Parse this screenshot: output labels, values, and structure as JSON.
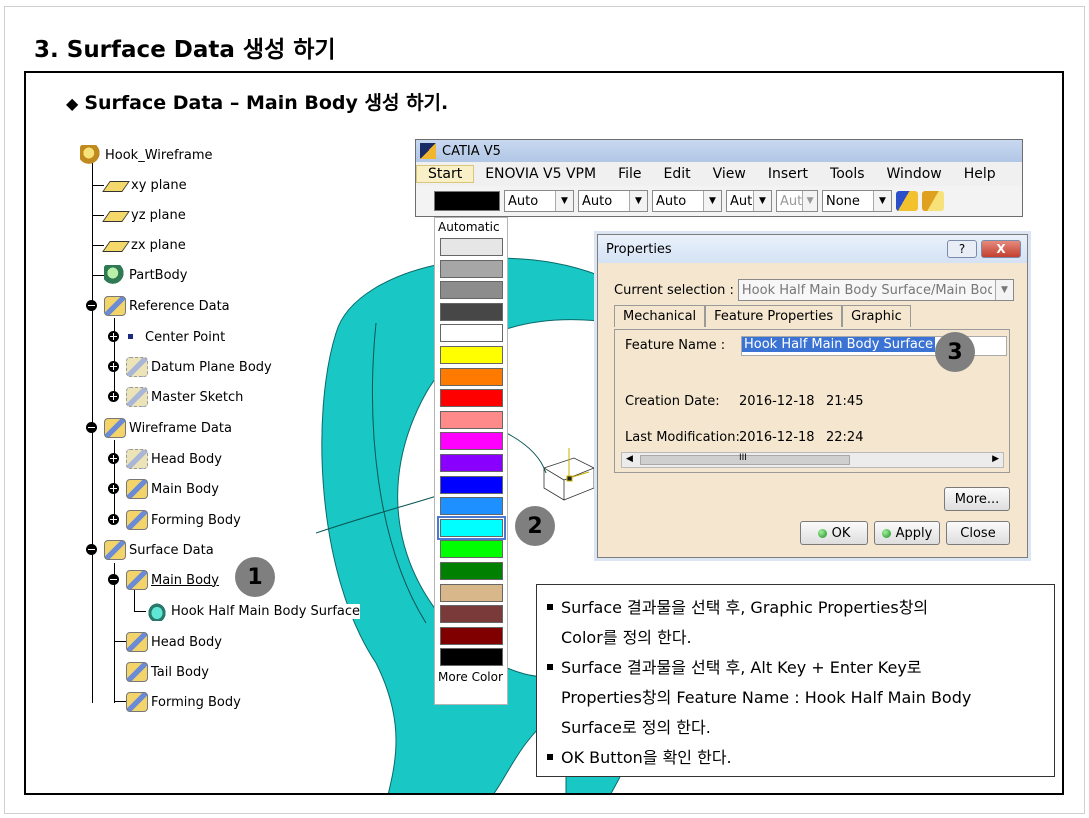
{
  "page": {
    "title": "3. Surface Data 생성 하기",
    "subtitle": "Surface Data – Main Body 생성 하기."
  },
  "tree": {
    "root": "Hook_Wireframe",
    "xy_plane": "xy plane",
    "yz_plane": "yz plane",
    "zx_plane": "zx plane",
    "partbody": "PartBody",
    "reference_data": "Reference Data",
    "center_point": "Center Point",
    "datum_plane_body": "Datum Plane Body",
    "master_sketch": "Master Sketch",
    "wireframe_data": "Wireframe Data",
    "wf_head_body": "Head Body",
    "wf_main_body": "Main Body",
    "wf_forming_body": "Forming Body",
    "surface_data": "Surface Data",
    "sd_main_body": "Main Body",
    "hook_half_surface": "Hook Half Main Body Surface",
    "sd_head_body": "Head Body",
    "sd_tail_body": "Tail Body",
    "sd_forming_body": "Forming Body"
  },
  "callouts": {
    "one": "1",
    "two": "2",
    "three": "3"
  },
  "catia": {
    "title": "CATIA V5",
    "menu": [
      "Start",
      "ENOVIA V5 VPM",
      "File",
      "Edit",
      "View",
      "Insert",
      "Tools",
      "Window",
      "Help"
    ],
    "toolbar": {
      "combo1": "Auto",
      "combo2": "Auto",
      "combo3": "Auto",
      "combo4": "Aut",
      "combo5": "Aut",
      "combo6": "None"
    }
  },
  "color_dropdown": {
    "automatic": "Automatic",
    "more": "More Color",
    "colors": [
      "#e6e6e6",
      "#a6a6a6",
      "#8c8c8c",
      "#474747",
      "#ffffff",
      "#ffff00",
      "#ff7a00",
      "#ff0000",
      "#ff8a8a",
      "#ff00ff",
      "#8a00ff",
      "#0000ff",
      "#1e90ff",
      "#00ffff",
      "#00ff00",
      "#008000",
      "#d8b88a",
      "#7a3a3a",
      "#800000",
      "#000000"
    ]
  },
  "properties": {
    "title": "Properties",
    "help_btn": "?",
    "close_btn": "X",
    "current_selection_label": "Current selection :",
    "current_selection_value": "Hook Half Main Body Surface/Main Body",
    "tabs": [
      "Mechanical",
      "Feature Properties",
      "Graphic"
    ],
    "feature_name_label": "Feature Name :",
    "feature_name_value": "Hook Half Main Body Surface",
    "creation_label": "Creation Date:",
    "creation_date": "2016-12-18",
    "creation_time": "21:45",
    "modification_label": "Last Modification:",
    "modification_date": "2016-12-18",
    "modification_time": "22:24",
    "scroll_thumb": "III",
    "more_btn": "More...",
    "ok_btn": "OK",
    "apply_btn": "Apply",
    "close_btn_label": "Close"
  },
  "notes": [
    "Surface 결과물을 선택 후, Graphic Properties창의",
    "Color를 정의 한다.",
    "Surface 결과물을 선택 후, Alt Key + Enter Key로",
    "Properties창의 Feature Name : Hook Half Main Body",
    "Surface로 정의 한다.",
    "OK Button을 확인 한다."
  ],
  "colors": {
    "teal": "#19c7c4",
    "frame": "#000000",
    "callout": "#7f7f7f",
    "dialog_bg": "#f4e6cf"
  }
}
